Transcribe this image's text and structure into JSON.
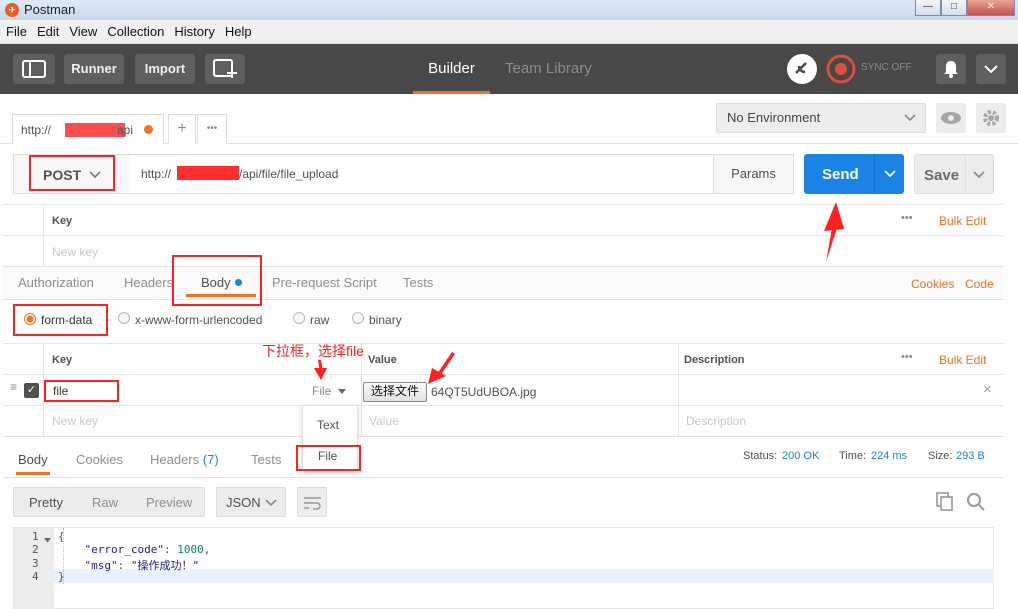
{
  "window": {
    "title": "Postman",
    "logo": "postman-logo",
    "controls": [
      "—",
      "□",
      "✕"
    ]
  },
  "menu": [
    "File",
    "Edit",
    "View",
    "Collection",
    "History",
    "Help"
  ],
  "header": {
    "runner": "Runner",
    "import": "Import",
    "tabs": {
      "builder": "Builder",
      "team_library": "Team Library"
    },
    "sync": "SYNC OFF",
    "accent": "#f47023"
  },
  "request_tab": {
    "label": "http://",
    "suffix": "api",
    "add": "+",
    "more": "•••"
  },
  "environment": {
    "selected": "No Environment"
  },
  "request": {
    "method": "POST",
    "url_prefix": "http://",
    "url_suffix": "/api/file/file_upload",
    "params": "Params",
    "send": "Send",
    "save": "Save"
  },
  "params_table": {
    "key_header": "Key",
    "key_placeholder": "New key",
    "more": "•••",
    "bulk_edit": "Bulk Edit"
  },
  "req_tabs": {
    "authorization": "Authorization",
    "headers": "Headers",
    "body": "Body",
    "prerequest": "Pre-request Script",
    "tests": "Tests",
    "cookies": "Cookies",
    "code": "Code"
  },
  "body_modes": {
    "form_data": "form-data",
    "urlencoded": "x-www-form-urlencoded",
    "raw": "raw",
    "binary": "binary"
  },
  "form_table": {
    "key": "Key",
    "value": "Value",
    "description": "Description",
    "more": "•••",
    "bulk_edit": "Bulk Edit",
    "row": {
      "key": "file",
      "type": "File",
      "choose_button": "选择文件",
      "filename": "64QT5UdUBOA.jpg",
      "remove": "×"
    },
    "new_key": "New key",
    "new_value": "Value",
    "new_desc": "Description"
  },
  "type_dropdown": {
    "options": [
      "Text",
      "File"
    ]
  },
  "annotation": "下拉框，选择file",
  "response": {
    "tabs": {
      "body": "Body",
      "cookies": "Cookies",
      "headers": "Headers",
      "headers_count": "(7)",
      "tests": "Tests"
    },
    "status_label": "Status:",
    "status": "200 OK",
    "time_label": "Time:",
    "time": "224 ms",
    "size_label": "Size:",
    "size": "293 B",
    "view_modes": {
      "pretty": "Pretty",
      "raw": "Raw",
      "preview": "Preview"
    },
    "format": "JSON",
    "lines": [
      "1",
      "2",
      "3",
      "4"
    ],
    "code": {
      "open": "{",
      "l2_key": "\"error_code\"",
      "l2_val": "1000",
      "l3_key": "\"msg\"",
      "l3_val": "\"操作成功！\"",
      "close": "}"
    }
  }
}
